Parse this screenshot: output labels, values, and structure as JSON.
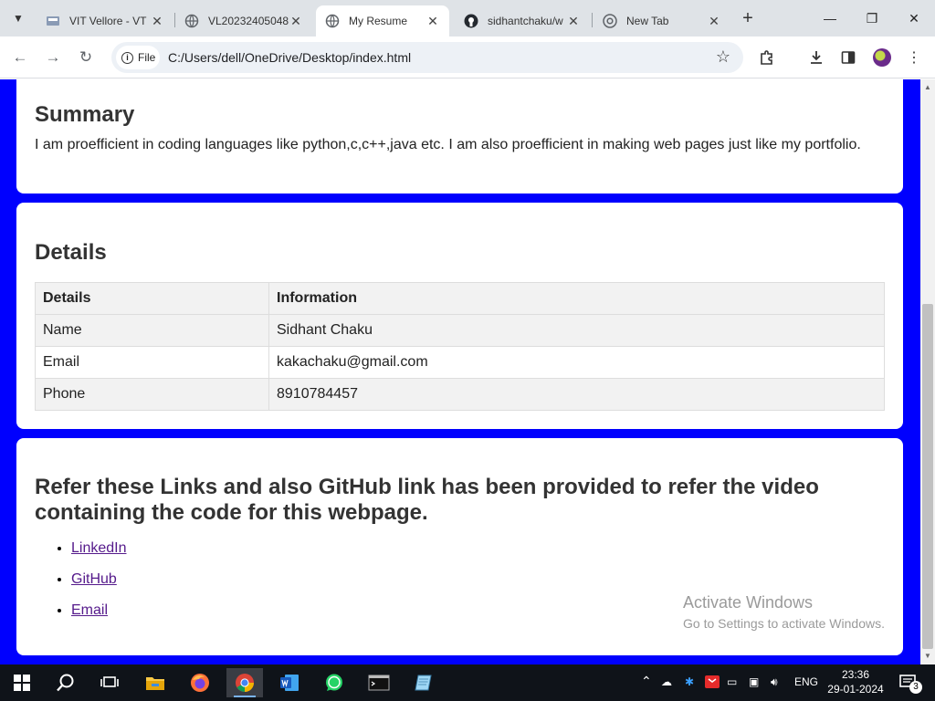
{
  "browser": {
    "tabs": [
      {
        "title": "VIT Vellore - VT"
      },
      {
        "title": "VL20232405048"
      },
      {
        "title": "My Resume"
      },
      {
        "title": "sidhantchaku/w"
      },
      {
        "title": "New Tab"
      }
    ],
    "address": {
      "scheme_chip": "File",
      "url": "C:/Users/dell/OneDrive/Desktop/index.html"
    }
  },
  "page": {
    "summary": {
      "heading": "Summary",
      "text": "I am proefficient in coding languages like python,c,c++,java etc. I am also proefficient in making web pages just like my portfolio."
    },
    "details": {
      "heading": "Details",
      "columns": [
        "Details",
        "Information"
      ],
      "rows": [
        [
          "Name",
          "Sidhant Chaku"
        ],
        [
          "Email",
          "kakachaku@gmail.com"
        ],
        [
          "Phone",
          "8910784457"
        ]
      ]
    },
    "links": {
      "heading": "Refer these Links and also GitHub link has been provided to refer the video containing the code for this webpage.",
      "items": [
        "LinkedIn",
        "GitHub",
        "Email"
      ]
    }
  },
  "watermark": {
    "line1": "Activate Windows",
    "line2": "Go to Settings to activate Windows."
  },
  "taskbar": {
    "language": "ENG",
    "time": "23:36",
    "date": "29-01-2024",
    "notification_count": "3"
  },
  "colors": {
    "page_background": "#0000fe",
    "link": "#551a8b",
    "tab_strip": "#dfe3e7",
    "taskbar": "#0f1319"
  }
}
